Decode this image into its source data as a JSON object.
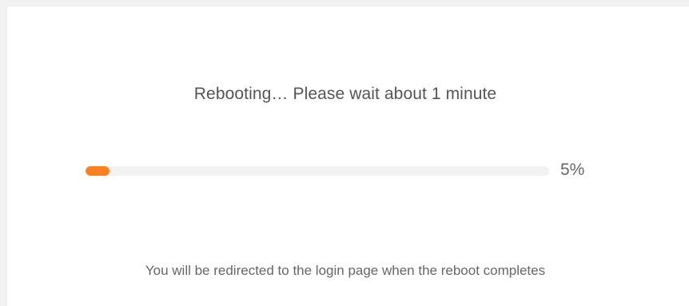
{
  "reboot": {
    "message": "Rebooting… Please wait about 1 minute",
    "progress_percent_label": "5%",
    "progress_fraction": 0.05,
    "redirect_note": "You will be redirected to the login page when the reboot completes"
  },
  "colors": {
    "accent": "#ff8020",
    "track": "#f2f2f2",
    "text": "#555555"
  }
}
